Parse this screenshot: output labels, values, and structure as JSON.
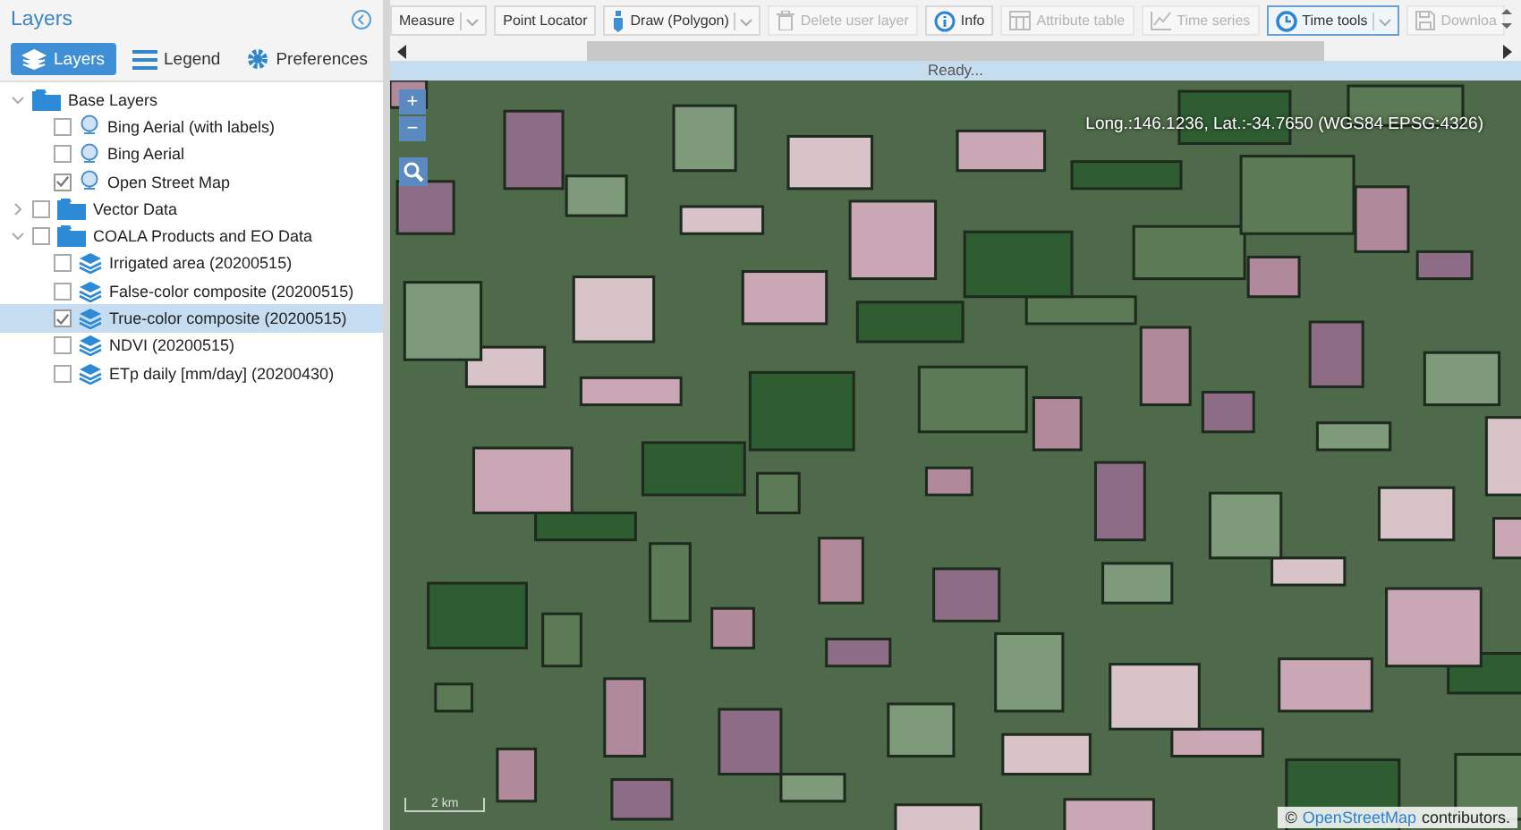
{
  "sidebar": {
    "title": "Layers",
    "tabs": [
      {
        "label": "Layers",
        "selected": true
      },
      {
        "label": "Legend",
        "selected": false
      },
      {
        "label": "Preferences",
        "selected": false
      }
    ],
    "tree": [
      {
        "label": "Base Layers",
        "kind": "basemap-group",
        "expanded": true,
        "children": [
          {
            "label": "Bing Aerial (with labels)",
            "kind": "basemap",
            "checked": false,
            "selected": false
          },
          {
            "label": "Bing Aerial",
            "kind": "basemap",
            "checked": false,
            "selected": false
          },
          {
            "label": "Open Street Map",
            "kind": "basemap",
            "checked": true,
            "selected": false
          }
        ]
      },
      {
        "label": "Vector Data",
        "kind": "layer-group",
        "expanded": false,
        "checked": false
      },
      {
        "label": "COALA Products and EO Data",
        "kind": "layer-group",
        "expanded": true,
        "checked": false,
        "children": [
          {
            "label": "Irrigated area (20200515)",
            "kind": "layer",
            "checked": false,
            "selected": false
          },
          {
            "label": "False-color composite (20200515)",
            "kind": "layer",
            "checked": false,
            "selected": false
          },
          {
            "label": "True-color composite (20200515)",
            "kind": "layer",
            "checked": true,
            "selected": true
          },
          {
            "label": "NDVI (20200515)",
            "kind": "layer",
            "checked": false,
            "selected": false
          },
          {
            "label": "ETp daily [mm/day] (20200430)",
            "kind": "layer",
            "checked": false,
            "selected": false
          }
        ]
      }
    ]
  },
  "toolbar": [
    {
      "label": "Measure",
      "dropdown": true,
      "disabled": false,
      "selected": false
    },
    {
      "label": "Point Locator",
      "dropdown": false,
      "disabled": false,
      "selected": false
    },
    {
      "label": "Draw (Polygon)",
      "dropdown": true,
      "disabled": false,
      "selected": false
    },
    {
      "label": "Delete user layer",
      "dropdown": false,
      "disabled": true,
      "selected": false
    },
    {
      "label": "Info",
      "dropdown": false,
      "disabled": false,
      "selected": false
    },
    {
      "label": "Attribute table",
      "dropdown": false,
      "disabled": true,
      "selected": false
    },
    {
      "label": "Time series",
      "dropdown": false,
      "disabled": true,
      "selected": false
    },
    {
      "label": "Time tools",
      "dropdown": true,
      "disabled": false,
      "selected": true
    },
    {
      "label": "Downloa",
      "dropdown": false,
      "disabled": true,
      "selected": false
    }
  ],
  "status": "Ready...",
  "map": {
    "coordinates": "Long.:146.1236, Lat.:-34.7650 (WGS84 EPSG:4326)",
    "zoom_in": "+",
    "zoom_out": "−",
    "scale": "2 km",
    "attribution_prefix": "©",
    "attribution_link": "OpenStreetMap",
    "attribution_suffix": "contributors."
  }
}
